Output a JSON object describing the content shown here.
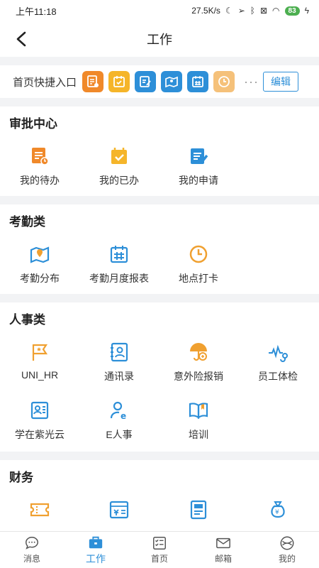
{
  "status": {
    "time": "上午11:18",
    "speed": "27.5K/s",
    "battery": "83"
  },
  "header": {
    "title": "工作"
  },
  "quick_entry": {
    "label": "首页快捷入口",
    "edit_label": "编辑",
    "more": "···"
  },
  "sections": {
    "approval": {
      "title": "审批中心",
      "items": [
        {
          "label": "我的待办",
          "icon": "todo-icon"
        },
        {
          "label": "我的已办",
          "icon": "done-icon"
        },
        {
          "label": "我的申请",
          "icon": "apply-icon"
        }
      ]
    },
    "attendance": {
      "title": "考勤类",
      "items": [
        {
          "label": "考勤分布",
          "icon": "map-icon"
        },
        {
          "label": "考勤月度报表",
          "icon": "calendar-icon"
        },
        {
          "label": "地点打卡",
          "icon": "clock-icon"
        }
      ]
    },
    "hr": {
      "title": "人事类",
      "items": [
        {
          "label": "UNI_HR",
          "icon": "flag-icon"
        },
        {
          "label": "通讯录",
          "icon": "contacts-icon"
        },
        {
          "label": "意外险报销",
          "icon": "umbrella-icon"
        },
        {
          "label": "员工体检",
          "icon": "stethoscope-icon"
        },
        {
          "label": "学在紫光云",
          "icon": "study-icon"
        },
        {
          "label": "E人事",
          "icon": "person-icon"
        },
        {
          "label": "培训",
          "icon": "book-icon"
        }
      ]
    },
    "finance": {
      "title": "财务"
    }
  },
  "tabs": [
    {
      "label": "消息",
      "icon": "message-icon"
    },
    {
      "label": "工作",
      "icon": "briefcase-icon"
    },
    {
      "label": "首页",
      "icon": "home-list-icon"
    },
    {
      "label": "邮箱",
      "icon": "mail-icon"
    },
    {
      "label": "我的",
      "icon": "profile-icon"
    }
  ],
  "colors": {
    "orange": "#f0892a",
    "yellow": "#f5b52a",
    "blue": "#2d8fd8",
    "bg": "#f2f3f5"
  }
}
